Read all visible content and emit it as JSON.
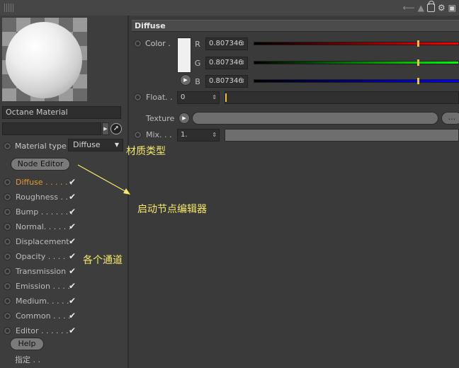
{
  "left_panel": {
    "material_name": "Octane Material",
    "material_type_label": "Material type",
    "material_type_value": "Diffuse",
    "node_editor_label": "Node Editor",
    "channels": [
      {
        "label": "Diffuse . . . . . .",
        "checked": true,
        "active": true
      },
      {
        "label": "Roughness . .",
        "checked": true,
        "active": false
      },
      {
        "label": "Bump . . . . . . .",
        "checked": true,
        "active": false
      },
      {
        "label": "Normal. . . . . .",
        "checked": true,
        "active": false
      },
      {
        "label": "Displacement",
        "checked": true,
        "active": false
      },
      {
        "label": "Opacity . . . .",
        "checked": true,
        "active": false
      },
      {
        "label": "Transmission",
        "checked": true,
        "active": false
      },
      {
        "label": "Emission . . . .",
        "checked": true,
        "active": false
      },
      {
        "label": "Medium. . . . .",
        "checked": true,
        "active": false
      },
      {
        "label": "Common . . . .",
        "checked": true,
        "active": false
      },
      {
        "label": "Editor . . . . . .",
        "checked": true,
        "active": false
      }
    ],
    "check_glyph": "✔",
    "help_label": "Help",
    "bottom_label": "指定 . ."
  },
  "right_panel": {
    "section_title": "Diffuse",
    "color_label": "Color .",
    "r_label": "R",
    "g_label": "G",
    "b_label": "B",
    "r_value": "0.807346",
    "g_value": "0.807346",
    "b_value": "0.807346",
    "color_fraction": 0.807346,
    "float_label": "Float. .",
    "float_value": "0",
    "texture_label": "Texture",
    "dots_label": "...",
    "mix_label": "Mix. . .",
    "mix_value": "1."
  },
  "annotations": {
    "material_type": "材质类型",
    "node_editor": "启动节点编辑器",
    "channels": "各个通道"
  },
  "colors": {
    "active_channel": "#e39a2a",
    "annotation": "#f5e96a",
    "slider_marker": "#f0c040"
  }
}
